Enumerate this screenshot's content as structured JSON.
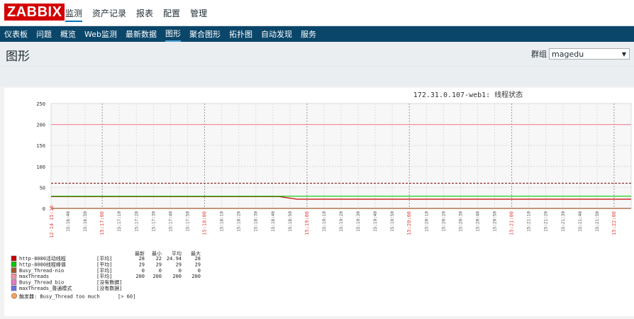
{
  "logo": "ZABBIX",
  "topnav": [
    {
      "label": "监测",
      "active": true
    },
    {
      "label": "资产记录",
      "active": false
    },
    {
      "label": "报表",
      "active": false
    },
    {
      "label": "配置",
      "active": false
    },
    {
      "label": "管理",
      "active": false
    }
  ],
  "subnav": [
    {
      "label": "仪表板",
      "active": false
    },
    {
      "label": "问题",
      "active": false
    },
    {
      "label": "概览",
      "active": false
    },
    {
      "label": "Web监测",
      "active": false
    },
    {
      "label": "最新数据",
      "active": false
    },
    {
      "label": "图形",
      "active": true
    },
    {
      "label": "聚合图形",
      "active": false
    },
    {
      "label": "拓扑图",
      "active": false
    },
    {
      "label": "自动发现",
      "active": false
    },
    {
      "label": "服务",
      "active": false
    }
  ],
  "page_title": "图形",
  "group_filter": {
    "label": "群组",
    "value": "magedu"
  },
  "chart_data": {
    "type": "line",
    "title": "172.31.0.107-web1: 线程状态",
    "ylim": [
      0,
      250
    ],
    "yticks": [
      0,
      50,
      100,
      150,
      200,
      250
    ],
    "x_start_label": "12-14 15:16",
    "x_tick_labels": [
      "15:16:40",
      "15:16:50",
      "15:17:00",
      "15:17:10",
      "15:17:20",
      "15:17:30",
      "15:17:40",
      "15:17:50",
      "15:18:00",
      "15:18:10",
      "15:18:20",
      "15:18:30",
      "15:18:40",
      "15:18:50",
      "15:19:00",
      "15:19:10",
      "15:19:20",
      "15:19:30",
      "15:19:40",
      "15:19:50",
      "15:20:00",
      "15:20:10",
      "15:20:20",
      "15:20:30",
      "15:20:40",
      "15:20:50",
      "15:21:00",
      "15:21:10",
      "15:21:20",
      "15:21:30",
      "15:21:40",
      "15:21:50",
      "15:22:00"
    ],
    "x_major_labels": [
      "15:17:00",
      "15:18:00",
      "15:19:00",
      "15:20:00",
      "15:21:00",
      "15:22:00"
    ],
    "grid": true,
    "series": [
      {
        "name": "http-8080活动线程",
        "agg": "[平均]",
        "last": "28",
        "min": "22",
        "avg": "24.94",
        "max": "28",
        "color": "#c80000",
        "values": [
          28,
          28,
          28,
          28,
          28,
          28,
          28,
          28,
          28,
          28,
          28,
          28,
          28,
          28,
          22,
          22,
          22,
          22,
          22,
          22,
          22,
          22,
          22,
          22,
          22,
          22,
          22,
          22,
          22,
          22,
          22,
          22,
          22,
          22
        ]
      },
      {
        "name": "http-8080线程峰值",
        "agg": "[平均]",
        "last": "29",
        "min": "29",
        "avg": "29",
        "max": "29",
        "color": "#00c800",
        "values": [
          29,
          29,
          29,
          29,
          29,
          29,
          29,
          29,
          29,
          29,
          29,
          29,
          29,
          29,
          29,
          29,
          29,
          29,
          29,
          29,
          29,
          29,
          29,
          29,
          29,
          29,
          29,
          29,
          29,
          29,
          29,
          29,
          29,
          29
        ]
      },
      {
        "name": "Busy_Thread-nio",
        "agg": "[平均]",
        "last": "0",
        "min": "0",
        "avg": "0",
        "max": "0",
        "color": "#a05a2c",
        "values": [
          0,
          0,
          0,
          0,
          0,
          0,
          0,
          0,
          0,
          0,
          0,
          0,
          0,
          0,
          0,
          0,
          0,
          0,
          0,
          0,
          0,
          0,
          0,
          0,
          0,
          0,
          0,
          0,
          0,
          0,
          0,
          0,
          0,
          0
        ]
      },
      {
        "name": "maxThreads",
        "agg": "[平均]",
        "last": "200",
        "min": "200",
        "avg": "200",
        "max": "200",
        "color": "#f48fa5",
        "values": [
          200,
          200,
          200,
          200,
          200,
          200,
          200,
          200,
          200,
          200,
          200,
          200,
          200,
          200,
          200,
          200,
          200,
          200,
          200,
          200,
          200,
          200,
          200,
          200,
          200,
          200,
          200,
          200,
          200,
          200,
          200,
          200,
          200,
          200
        ]
      },
      {
        "name": "Busy_Thread_bio",
        "agg": "[没有数据]",
        "last": "",
        "min": "",
        "avg": "",
        "max": "",
        "color": "#e878c0",
        "values": []
      },
      {
        "name": "maxThreads_普通模式",
        "agg": "[没有数据]",
        "last": "",
        "min": "",
        "avg": "",
        "max": "",
        "color": "#7070e0",
        "values": []
      }
    ],
    "trigger": {
      "label": "触发器: Busy_Thread too much",
      "condition": "[> 60]",
      "value": 60,
      "color": "#c07050"
    },
    "legend_headers": [
      "最新",
      "最小",
      "平均",
      "最大"
    ]
  }
}
